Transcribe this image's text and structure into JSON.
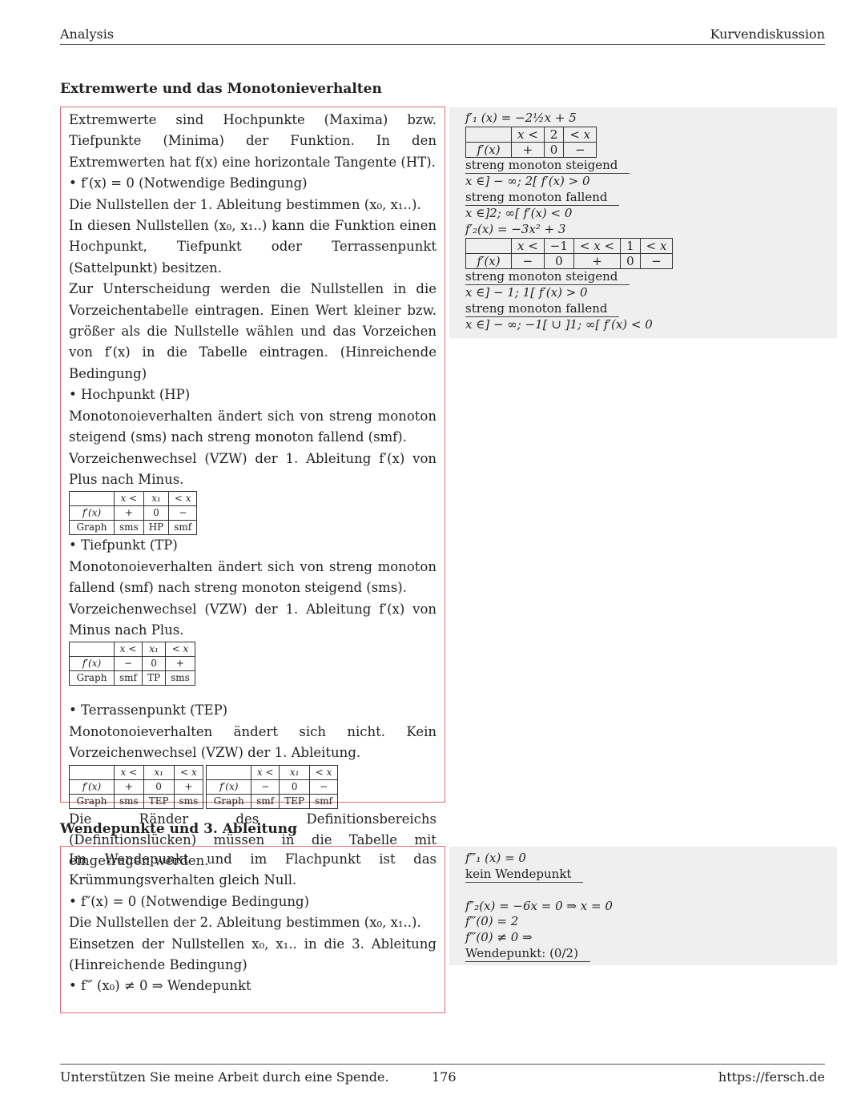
{
  "header": {
    "left": "Analysis",
    "right": "Kurvendiskussion"
  },
  "section1": {
    "title": "Extremwerte und das Monotonieverhalten",
    "paragraphs": [
      "Extremwerte sind Hochpunkte (Maxima) bzw. Tiefpunkte (Minima) der Funktion. In den Extremwerten hat f(x) eine horizontale Tangente (HT).",
      "• f′(x) = 0 (Notwendige Bedingung)",
      "Die Nullstellen der 1. Ableitung bestimmen (x₀, x₁..).",
      "In diesen Nullstellen (x₀, x₁..) kann die Funktion einen Hochpunkt, Tiefpunkt oder Terrassenpunkt (Sattelpunkt) besitzen.",
      "Zur Unterscheidung werden die Nullstellen in die Vorzeichentabelle eintragen. Einen Wert kleiner bzw. größer als die Nullstelle wählen und das Vorzeichen von f′(x) in die Tabelle eintragen. (Hinreichende Bedingung)",
      "• Hochpunkt (HP)",
      "Monotonoieverhalten ändert sich von streng monoton steigend (sms) nach streng monoton fallend (smf).",
      "Vorzeichenwechsel (VZW) der 1. Ableitung f′(x) von Plus nach Minus."
    ],
    "hp_table": {
      "header": [
        "",
        "x <",
        "x₁",
        "< x"
      ],
      "rows": [
        [
          "f′(x)",
          "+",
          "0",
          "−"
        ],
        [
          "Graph",
          "sms",
          "HP",
          "smf"
        ]
      ]
    },
    "tp_paragraphs": [
      "• Tiefpunkt (TP)",
      "Monotonoieverhalten ändert sich von streng monoton fallend (smf) nach streng monoton steigend (sms).",
      "Vorzeichenwechsel (VZW) der 1. Ableitung f′(x) von Minus nach Plus."
    ],
    "tp_table": {
      "header": [
        "",
        "x <",
        "x₁",
        "< x"
      ],
      "rows": [
        [
          "f′(x)",
          "−",
          "0",
          "+"
        ],
        [
          "Graph",
          "smf",
          "TP",
          "sms"
        ]
      ]
    },
    "tep_paragraphs": [
      "• Terrassenpunkt (TEP)",
      "Monotonoieverhalten ändert sich nicht. Kein Vorzeichenwechsel (VZW) der 1. Ableitung."
    ],
    "tep_table_1": {
      "header": [
        "",
        "x <",
        "x₁",
        "< x"
      ],
      "rows": [
        [
          "f′(x)",
          "+",
          "0",
          "+"
        ],
        [
          "Graph",
          "sms",
          "TEP",
          "sms"
        ]
      ]
    },
    "tep_table_2": {
      "header": [
        "",
        "x <",
        "x₁",
        "< x"
      ],
      "rows": [
        [
          "f′(x)",
          "−",
          "0",
          "−"
        ],
        [
          "Graph",
          "smf",
          "TEP",
          "smf"
        ]
      ]
    },
    "closing": "Die Ränder des Definitionsbereichs (Definitionslücken) müssen in die Tabelle mit eingetragen werden."
  },
  "example1": {
    "f1_formula": "f′₁ (x) = −2½x + 5",
    "f1_table": {
      "header": [
        "",
        "x <",
        "2",
        "< x"
      ],
      "rows": [
        [
          "f′(x)",
          "+",
          "0",
          "−"
        ]
      ]
    },
    "f1_sms_label": "streng monoton steigend",
    "f1_sms_interval": "x ∈] − ∞; 2[   f′(x) > 0",
    "f1_smf_label": "streng monoton fallend",
    "f1_smf_interval": "x ∈]2; ∞[   f′(x) < 0",
    "f2_formula": "f′₂(x) = −3x² + 3",
    "f2_table": {
      "header": [
        "",
        "x <",
        "−1",
        "< x <",
        "1",
        "< x"
      ],
      "rows": [
        [
          "f′(x)",
          "−",
          "0",
          "+",
          "0",
          "−"
        ]
      ]
    },
    "f2_sms_label": "streng monoton steigend",
    "f2_sms_interval": "x ∈] − 1; 1[   f′(x) > 0",
    "f2_smf_label": "streng monoton fallend",
    "f2_smf_interval": "x ∈] − ∞; −1[  ∪  ]1; ∞[   f′(x) < 0"
  },
  "section2": {
    "title": "Wendepunkte und 3. Ableitung",
    "paragraphs": [
      "Im Wendepunkt und im Flachpunkt ist das Krümmungsverhalten gleich Null.",
      "• f″(x) = 0 (Notwendige Bedingung)",
      "Die Nullstellen der 2. Ableitung bestimmen (x₀, x₁..).",
      "Einsetzen der Nullstellen x₀, x₁.. in die 3. Ableitung (Hinreichende Bedingung)",
      "• f‴ (x₀) ≠ 0 ⇒ Wendepunkt"
    ]
  },
  "example2": {
    "lines": [
      "f‴₁ (x) = 0",
      "kein Wendepunkt",
      "",
      "f″₂(x) = −6x = 0 ⇒ x = 0",
      "f‴(0) = 2",
      "f‴(0) ≠ 0 ⇒",
      "Wendepunkt: (0/2)"
    ]
  },
  "footer": {
    "left": "Unterstützen Sie meine Arbeit durch eine Spende.",
    "page": "176",
    "right": "https://fersch.de"
  },
  "colors": {
    "box_border": "#e06a70",
    "panel_bg": "#efefef"
  }
}
